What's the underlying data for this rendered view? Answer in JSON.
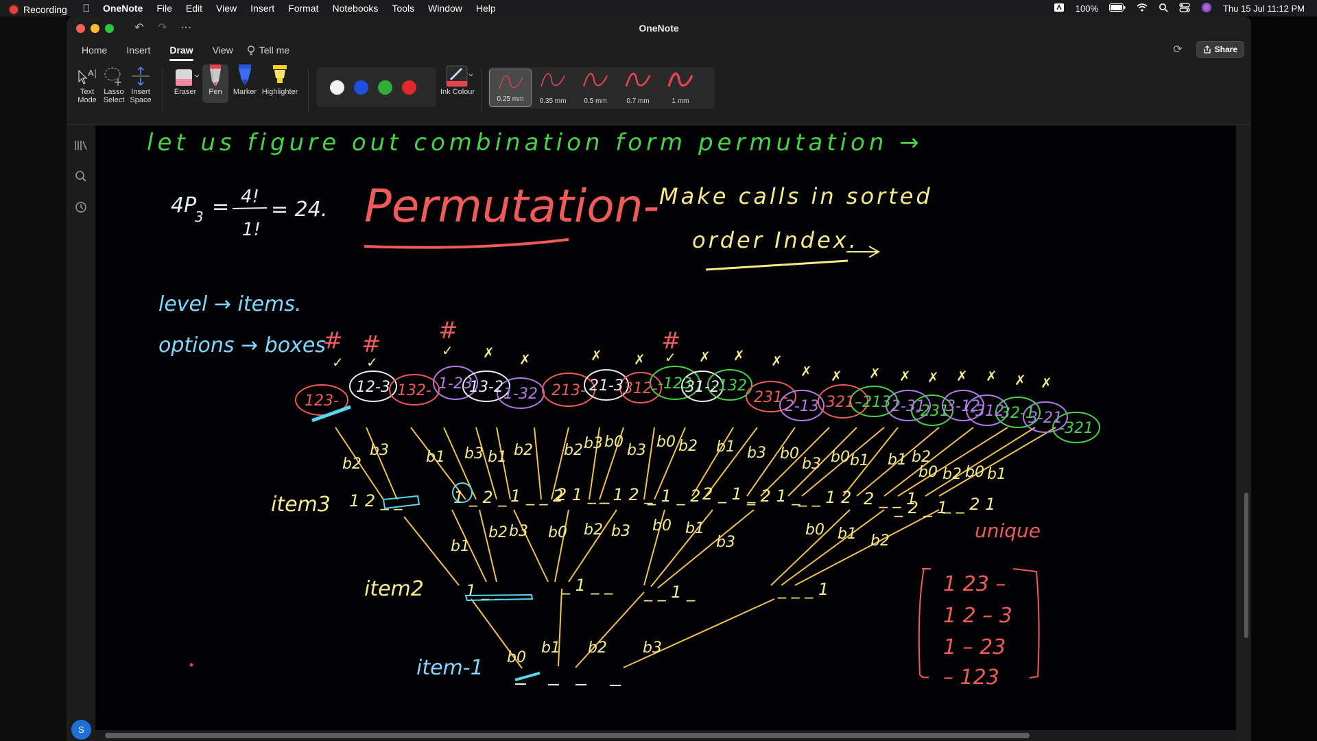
{
  "recording": {
    "label": "Recording"
  },
  "menubar": {
    "app_name": "OneNote",
    "items": [
      "File",
      "Edit",
      "View",
      "Insert",
      "Format",
      "Notebooks",
      "Tools",
      "Window",
      "Help"
    ],
    "battery": "100%",
    "clock": "Thu 15 Jul  11:12 PM"
  },
  "window": {
    "title": "OneNote"
  },
  "ribbon_tabs": {
    "home": "Home",
    "insert": "Insert",
    "draw": "Draw",
    "view": "View",
    "tell_me": "Tell me",
    "active": "Draw"
  },
  "share": {
    "label": "Share"
  },
  "tools": {
    "text_mode": "Text Mode",
    "lasso_select": "Lasso Select",
    "insert_space": "Insert Space",
    "eraser": "Eraser",
    "pen": "Pen",
    "marker": "Marker",
    "highlighter": "Highlighter",
    "ink_colour": "Ink Colour"
  },
  "swatch_colors": [
    "#f2f2f2",
    "#1f4fe0",
    "#2fae3a",
    "#e02a2a"
  ],
  "pen_widths": [
    "0.25 mm",
    "0.35 mm",
    "0.5 mm",
    "0.7 mm",
    "1 mm"
  ],
  "selected_width": "0.25 mm",
  "pen_color": "#e8434c",
  "avatar": {
    "initial": "S"
  },
  "ink": {
    "line1": "let us figure out combination form permutation →",
    "formula_left": "4P",
    "formula_sub": "3",
    "formula_eq": "=",
    "formula_num": "4!",
    "formula_den": "1!",
    "formula_result": "= 24.",
    "heading": "Permutation-",
    "note_line1": "Make calls in sorted",
    "note_line2": "order Index.",
    "level": "level → items.",
    "options": "options → boxes",
    "item3": "item3",
    "item2": "item2",
    "item1": "item-1",
    "unique": "unique",
    "unique_rows": [
      "1 23 –",
      "1 2 – 3",
      "1 – 23",
      "– 123"
    ],
    "level3_nodes": [
      "1 2 _ _",
      "1 _ 2 _",
      "1 _ _ 2",
      "2 1 _ _",
      "_ 1 2 _",
      "_ 1 _ 2",
      "2 _ 1 _",
      "_ 2 1 _",
      "_ _ 1 2",
      "2 _ _ 1",
      "_ 2 _ 1",
      "_ _ 2 1"
    ],
    "level2_nodes": [
      "1 _ _ _",
      "_ 1 _ _",
      "_ _ 1 _",
      "_ _ _ 1"
    ],
    "level1_nodes": [
      "_",
      "_",
      "_",
      "_"
    ],
    "branch_labels": [
      "b0",
      "b1",
      "b2",
      "b3"
    ],
    "leaves": [
      "123-",
      "12-3",
      "132-",
      "1-23",
      "13-2",
      "1-32",
      "213-",
      "21-3",
      "312-",
      "-123",
      "31-2",
      "-132",
      "231-",
      "2-13",
      "321-",
      "-213",
      "2-31",
      "-231",
      "3-12",
      "-312",
      "32-1",
      "3-21",
      "-321",
      "3-21"
    ],
    "marks": [
      "#",
      "#",
      "#",
      "#",
      "✓",
      "✗"
    ]
  }
}
